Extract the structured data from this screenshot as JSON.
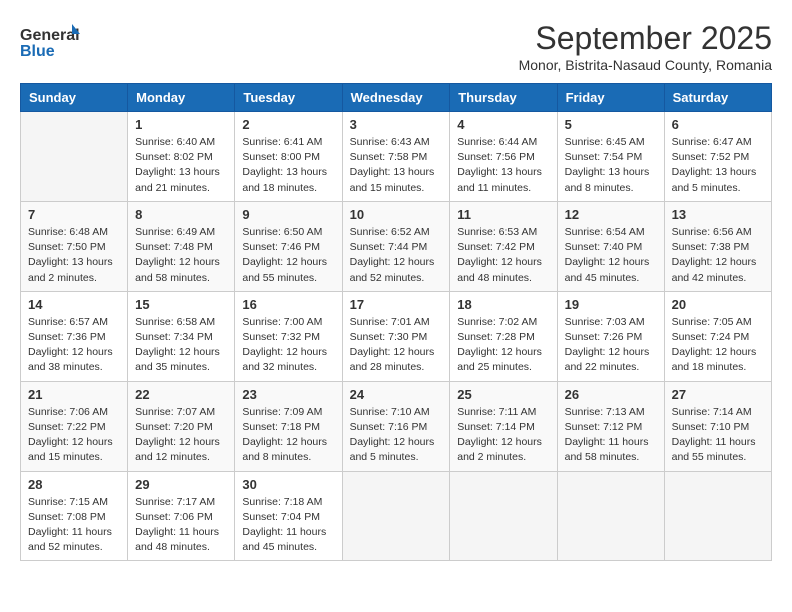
{
  "header": {
    "logo_general": "General",
    "logo_blue": "Blue",
    "month_title": "September 2025",
    "location": "Monor, Bistrita-Nasaud County, Romania"
  },
  "weekdays": [
    "Sunday",
    "Monday",
    "Tuesday",
    "Wednesday",
    "Thursday",
    "Friday",
    "Saturday"
  ],
  "weeks": [
    [
      {
        "day": "",
        "info": ""
      },
      {
        "day": "1",
        "info": "Sunrise: 6:40 AM\nSunset: 8:02 PM\nDaylight: 13 hours\nand 21 minutes."
      },
      {
        "day": "2",
        "info": "Sunrise: 6:41 AM\nSunset: 8:00 PM\nDaylight: 13 hours\nand 18 minutes."
      },
      {
        "day": "3",
        "info": "Sunrise: 6:43 AM\nSunset: 7:58 PM\nDaylight: 13 hours\nand 15 minutes."
      },
      {
        "day": "4",
        "info": "Sunrise: 6:44 AM\nSunset: 7:56 PM\nDaylight: 13 hours\nand 11 minutes."
      },
      {
        "day": "5",
        "info": "Sunrise: 6:45 AM\nSunset: 7:54 PM\nDaylight: 13 hours\nand 8 minutes."
      },
      {
        "day": "6",
        "info": "Sunrise: 6:47 AM\nSunset: 7:52 PM\nDaylight: 13 hours\nand 5 minutes."
      }
    ],
    [
      {
        "day": "7",
        "info": "Sunrise: 6:48 AM\nSunset: 7:50 PM\nDaylight: 13 hours\nand 2 minutes."
      },
      {
        "day": "8",
        "info": "Sunrise: 6:49 AM\nSunset: 7:48 PM\nDaylight: 12 hours\nand 58 minutes."
      },
      {
        "day": "9",
        "info": "Sunrise: 6:50 AM\nSunset: 7:46 PM\nDaylight: 12 hours\nand 55 minutes."
      },
      {
        "day": "10",
        "info": "Sunrise: 6:52 AM\nSunset: 7:44 PM\nDaylight: 12 hours\nand 52 minutes."
      },
      {
        "day": "11",
        "info": "Sunrise: 6:53 AM\nSunset: 7:42 PM\nDaylight: 12 hours\nand 48 minutes."
      },
      {
        "day": "12",
        "info": "Sunrise: 6:54 AM\nSunset: 7:40 PM\nDaylight: 12 hours\nand 45 minutes."
      },
      {
        "day": "13",
        "info": "Sunrise: 6:56 AM\nSunset: 7:38 PM\nDaylight: 12 hours\nand 42 minutes."
      }
    ],
    [
      {
        "day": "14",
        "info": "Sunrise: 6:57 AM\nSunset: 7:36 PM\nDaylight: 12 hours\nand 38 minutes."
      },
      {
        "day": "15",
        "info": "Sunrise: 6:58 AM\nSunset: 7:34 PM\nDaylight: 12 hours\nand 35 minutes."
      },
      {
        "day": "16",
        "info": "Sunrise: 7:00 AM\nSunset: 7:32 PM\nDaylight: 12 hours\nand 32 minutes."
      },
      {
        "day": "17",
        "info": "Sunrise: 7:01 AM\nSunset: 7:30 PM\nDaylight: 12 hours\nand 28 minutes."
      },
      {
        "day": "18",
        "info": "Sunrise: 7:02 AM\nSunset: 7:28 PM\nDaylight: 12 hours\nand 25 minutes."
      },
      {
        "day": "19",
        "info": "Sunrise: 7:03 AM\nSunset: 7:26 PM\nDaylight: 12 hours\nand 22 minutes."
      },
      {
        "day": "20",
        "info": "Sunrise: 7:05 AM\nSunset: 7:24 PM\nDaylight: 12 hours\nand 18 minutes."
      }
    ],
    [
      {
        "day": "21",
        "info": "Sunrise: 7:06 AM\nSunset: 7:22 PM\nDaylight: 12 hours\nand 15 minutes."
      },
      {
        "day": "22",
        "info": "Sunrise: 7:07 AM\nSunset: 7:20 PM\nDaylight: 12 hours\nand 12 minutes."
      },
      {
        "day": "23",
        "info": "Sunrise: 7:09 AM\nSunset: 7:18 PM\nDaylight: 12 hours\nand 8 minutes."
      },
      {
        "day": "24",
        "info": "Sunrise: 7:10 AM\nSunset: 7:16 PM\nDaylight: 12 hours\nand 5 minutes."
      },
      {
        "day": "25",
        "info": "Sunrise: 7:11 AM\nSunset: 7:14 PM\nDaylight: 12 hours\nand 2 minutes."
      },
      {
        "day": "26",
        "info": "Sunrise: 7:13 AM\nSunset: 7:12 PM\nDaylight: 11 hours\nand 58 minutes."
      },
      {
        "day": "27",
        "info": "Sunrise: 7:14 AM\nSunset: 7:10 PM\nDaylight: 11 hours\nand 55 minutes."
      }
    ],
    [
      {
        "day": "28",
        "info": "Sunrise: 7:15 AM\nSunset: 7:08 PM\nDaylight: 11 hours\nand 52 minutes."
      },
      {
        "day": "29",
        "info": "Sunrise: 7:17 AM\nSunset: 7:06 PM\nDaylight: 11 hours\nand 48 minutes."
      },
      {
        "day": "30",
        "info": "Sunrise: 7:18 AM\nSunset: 7:04 PM\nDaylight: 11 hours\nand 45 minutes."
      },
      {
        "day": "",
        "info": ""
      },
      {
        "day": "",
        "info": ""
      },
      {
        "day": "",
        "info": ""
      },
      {
        "day": "",
        "info": ""
      }
    ]
  ]
}
